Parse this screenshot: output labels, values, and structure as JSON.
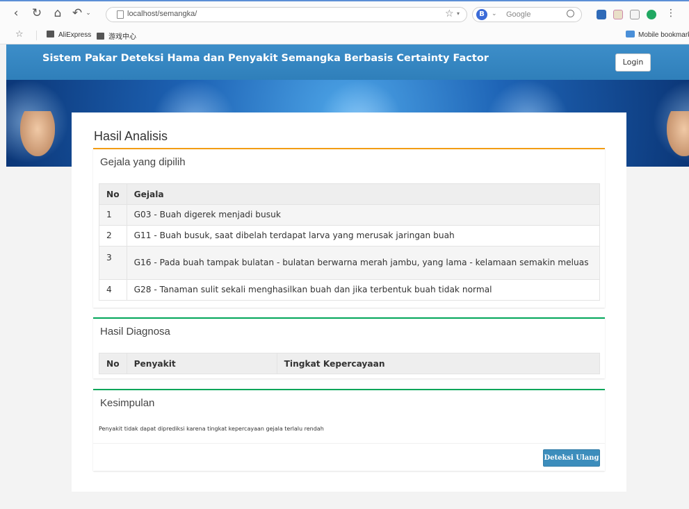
{
  "browser": {
    "url": "localhost/semangka/",
    "search_placeholder": "Google",
    "bookmarks": [
      "AliExpress",
      "游戏中心"
    ],
    "mobile_bookmarks": "Mobile bookmark"
  },
  "header": {
    "title": "Sistem Pakar Deteksi Hama dan Penyakit Semangka Berbasis Certainty Factor",
    "login_label": "Login"
  },
  "page_title": "Hasil Analisis",
  "gejala": {
    "title": "Gejala yang dipilih",
    "columns": [
      "No",
      "Gejala"
    ],
    "rows": [
      {
        "no": "1",
        "text": "G03 - Buah digerek menjadi busuk"
      },
      {
        "no": "2",
        "text": "G11 - Buah busuk, saat dibelah terdapat larva yang merusak jaringan buah"
      },
      {
        "no": "3",
        "text": "G16 - Pada buah tampak bulatan - bulatan berwarna merah jambu, yang lama - kelamaan semakin meluas"
      },
      {
        "no": "4",
        "text": "G28 - Tanaman sulit sekali menghasilkan buah dan jika terbentuk buah tidak normal"
      }
    ]
  },
  "diagnosa": {
    "title": "Hasil Diagnosa",
    "columns": [
      "No",
      "Penyakit",
      "Tingkat Kepercayaan"
    ]
  },
  "kesimpulan": {
    "title": "Kesimpulan",
    "text": "Penyakit tidak dapat diprediksi karena tingkat kepercayaan gejala terlalu rendah",
    "button_label": "Deteksi Ulang"
  },
  "colors": {
    "header": "#3d8ec9",
    "orange_border": "#f39c12",
    "green_border": "#00a65a",
    "button": "#3c8dbc"
  }
}
